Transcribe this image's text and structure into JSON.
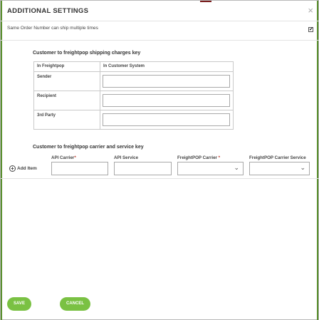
{
  "dialog": {
    "title": "ADDITIONAL SETTINGS",
    "close_glyph": "×"
  },
  "option": {
    "label": "Same Order Number can ship multiple times",
    "checked": true,
    "check_glyph": "✔"
  },
  "shipping_charges": {
    "title": "Customer to freightpop shipping charges key",
    "headers": [
      "In Freightpop",
      "In Customer System"
    ],
    "rows": [
      {
        "label": "Sender",
        "value": ""
      },
      {
        "label": "Recipient",
        "value": ""
      },
      {
        "label": "3rd Party",
        "value": ""
      }
    ]
  },
  "carrier_service": {
    "title": "Customer to freightpop carrier and service key",
    "add_item_label": "Add Item",
    "add_icon": "plus-circle-icon",
    "columns": [
      {
        "label": "API Carrier",
        "required": true,
        "type": "text",
        "value": ""
      },
      {
        "label": "API Service",
        "required": false,
        "type": "text",
        "value": ""
      },
      {
        "label": "FreightPOP Carrier",
        "required": true,
        "type": "select",
        "value": ""
      },
      {
        "label": "FreightPOP Carrier Service",
        "required": false,
        "type": "select",
        "value": ""
      }
    ],
    "required_marker": "*",
    "chevron_glyph": "⌄"
  },
  "footer": {
    "save_label": "SAVE",
    "cancel_label": "CANCEL"
  },
  "colors": {
    "accent": "#7ac143",
    "required": "#c0392b"
  }
}
